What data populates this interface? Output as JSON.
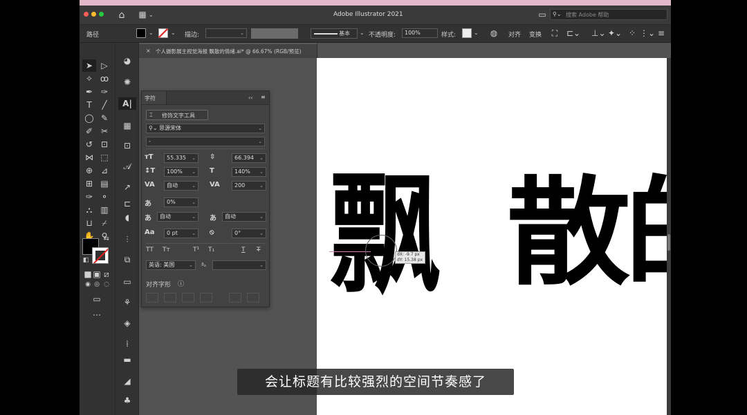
{
  "app": {
    "title": "Adobe Illustrator 2021",
    "help_placeholder": "搜索 Adobe 帮助"
  },
  "option_bar": {
    "selection": "路径",
    "stroke_label": "描边:",
    "stroke_style": "基本",
    "opacity_label": "不透明度:",
    "opacity_value": "100%",
    "style_label": "样式:",
    "align_label": "对齐",
    "transform_label": "变换"
  },
  "document_tab": {
    "title": "个人摄影展主视觉海报 飘散的情绪.ai* @ 66.67% (RGB/预览)",
    "close": "×"
  },
  "character_panel": {
    "title": "字符",
    "touch_type_button": "修饰文字工具",
    "font_family": "思源宋体",
    "font_style": "-",
    "font_size": "55.335",
    "leading": "66.394",
    "vertical_scale": "100%",
    "horizontal_scale": "140%",
    "kerning": "自动",
    "tracking": "200",
    "tsume": "0%",
    "aki_left": "自动",
    "aki_right": "自动",
    "baseline_shift": "0 pt",
    "rotation": "0°",
    "language": "英语: 美国",
    "align_glyphs_label": "对齐字形"
  },
  "artboard": {
    "glyphs": [
      "飘",
      "散",
      "的"
    ],
    "tooltip_dx": "dX: -9.7 px",
    "tooltip_dy": "dY: 15.38 px"
  },
  "subtitle": "会让标题有比较强烈的空间节奏感了"
}
